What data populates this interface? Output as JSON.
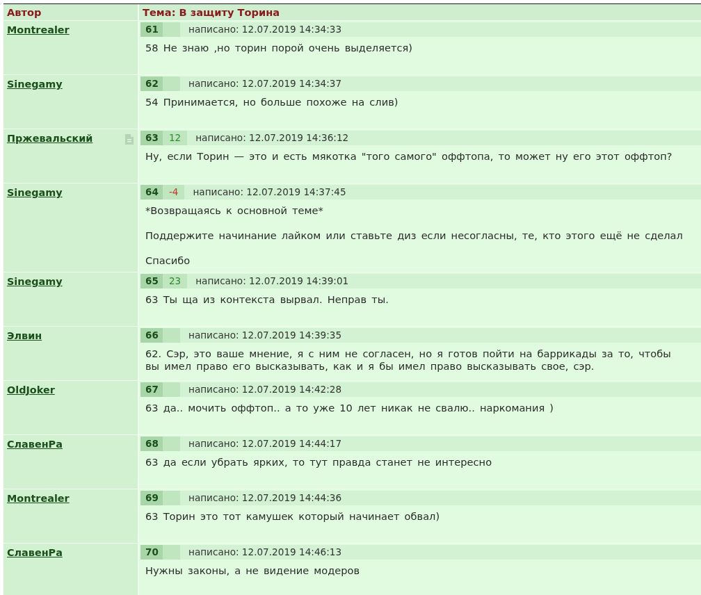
{
  "header": {
    "author_column": "Автор",
    "topic_column": "Тема: В защиту Торина"
  },
  "posts": [
    {
      "author": "Montrealer",
      "has_document": false,
      "number": "61",
      "date": "написано: 12.07.2019 14:34:33",
      "paragraphs": [
        "58 Не знаю ,но торин порой очень выделяется)"
      ]
    },
    {
      "author": "Sinegamy",
      "has_document": false,
      "number": "62",
      "date": "написано: 12.07.2019 14:34:37",
      "paragraphs": [
        "54 Принимается, но больше похоже на слив)"
      ]
    },
    {
      "author": "Пржевальский",
      "has_document": true,
      "number": "63",
      "rating": {
        "text": "12",
        "color": "#2e8b2e"
      },
      "date": "написано: 12.07.2019 14:36:12",
      "paragraphs": [
        "Ну, если Торин — это и есть мякотка \"того самого\" оффтопа, то может ну его этот оффтоп?"
      ]
    },
    {
      "author": "Sinegamy",
      "has_document": false,
      "number": "64",
      "rating": {
        "text": "-4",
        "color": "#c0392b"
      },
      "date": "написано: 12.07.2019 14:37:45",
      "paragraphs": [
        "*Возвращаясь к основной теме*",
        "Поддержите начинание лайком или ставьте диз если несогласны, те, кто этого ещё не сделал",
        "Спасибо"
      ]
    },
    {
      "author": "Sinegamy",
      "has_document": false,
      "number": "65",
      "rating": {
        "text": "23",
        "color": "#2e8b2e"
      },
      "date": "написано: 12.07.2019 14:39:01",
      "paragraphs": [
        "63 Ты ща из контекста вырвал. Неправ ты."
      ]
    },
    {
      "author": "Элвин",
      "has_document": false,
      "number": "66",
      "date": "написано: 12.07.2019 14:39:35",
      "paragraphs": [
        "62. Сэр, это ваше мнение, я с ним не согласен, но я готов пойти на баррикады за то, чтобы вы имел право его высказывать, как и я бы имел право высказывать свое, сэр."
      ]
    },
    {
      "author": "OldJoker",
      "has_document": false,
      "number": "67",
      "date": "написано: 12.07.2019 14:42:28",
      "paragraphs": [
        "63 да.. мочить оффтоп.. а то уже 10 лет никак не свалю.. наркомания )"
      ]
    },
    {
      "author": "СлавенРа",
      "has_document": false,
      "number": "68",
      "date": "написано: 12.07.2019 14:44:17",
      "paragraphs": [
        "63 да если убрать ярких, то тут правда станет не интересно"
      ]
    },
    {
      "author": "Montrealer",
      "has_document": false,
      "number": "69",
      "date": "написано: 12.07.2019 14:44:36",
      "paragraphs": [
        "63 Торин это тот камушек который начинает обвал)"
      ]
    },
    {
      "author": "СлавенРа",
      "has_document": false,
      "number": "70",
      "date": "написано: 12.07.2019 14:46:13",
      "paragraphs": [
        "Нужны законы, а не видение модеров"
      ]
    }
  ]
}
